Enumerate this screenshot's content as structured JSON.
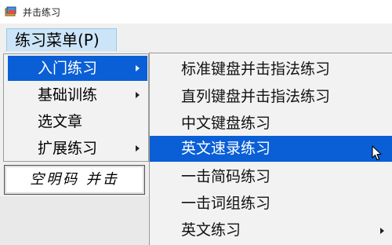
{
  "window": {
    "title": "并击练习",
    "icon": "app-icon"
  },
  "menubar": {
    "active_menu": "练习菜单(P)"
  },
  "menu1": {
    "items": [
      {
        "label": "入门练习",
        "has_submenu": true,
        "highlighted": true
      },
      {
        "label": "基础训练",
        "has_submenu": true,
        "highlighted": false
      },
      {
        "label": "选文章",
        "has_submenu": false,
        "highlighted": false
      },
      {
        "label": "扩展练习",
        "has_submenu": true,
        "highlighted": false
      }
    ]
  },
  "special_button": {
    "label": "空明码 并击"
  },
  "submenu": {
    "items": [
      {
        "label": "标准键盘并击指法练习",
        "has_submenu": false,
        "highlighted": false
      },
      {
        "label": "直列键盘并击指法练习",
        "has_submenu": false,
        "highlighted": false
      },
      {
        "label": "中文键盘练习",
        "has_submenu": false,
        "highlighted": false
      },
      {
        "label": "英文速录练习",
        "has_submenu": false,
        "highlighted": true
      },
      {
        "label": "一击简码练习",
        "has_submenu": false,
        "highlighted": false
      },
      {
        "label": "一击词组练习",
        "has_submenu": false,
        "highlighted": false
      },
      {
        "label": "英文练习",
        "has_submenu": true,
        "highlighted": false
      }
    ]
  },
  "colors": {
    "highlight": "#0a5fd6",
    "menubar_active": "#cce4f7",
    "menu_bg": "#f2f2f2"
  }
}
